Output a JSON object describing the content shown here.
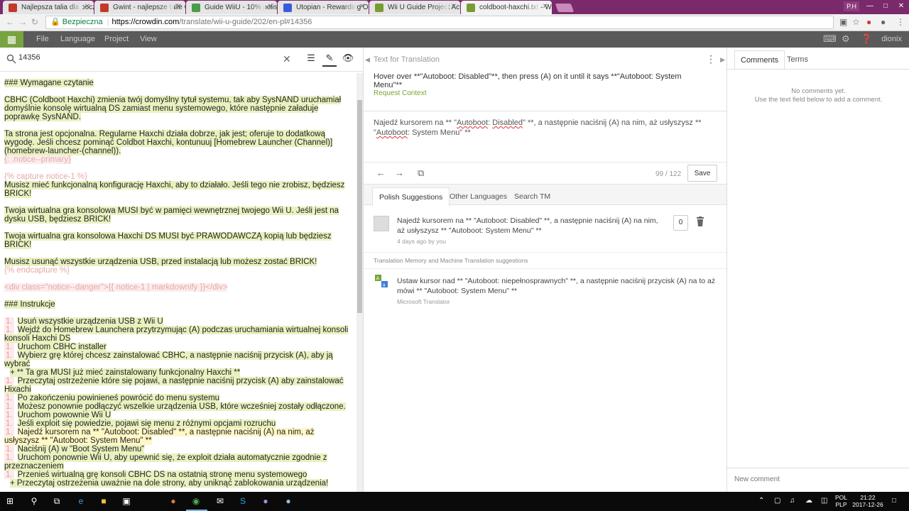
{
  "browser": {
    "profile": "P.H",
    "tabs": [
      {
        "title": "Najlepsza talia dla począt",
        "color": "#c0392b"
      },
      {
        "title": "Gwint - najlepsze talie w",
        "color": "#c0392b"
      },
      {
        "title": "Guide WiiU - 10% polish",
        "color": "#4a9b4a"
      },
      {
        "title": "Utopian - Rewarding Op",
        "color": "#3b5bdb"
      },
      {
        "title": "Wii U Guide Project Activ",
        "color": "#7a9b34"
      },
      {
        "title": "coldboot-haxchi.txt - W",
        "color": "#7a9b34"
      }
    ],
    "address": {
      "secure_label": "Bezpieczna",
      "host": "https://crowdin.com",
      "path": "/translate/wii-u-guide/202/en-pl#14356"
    }
  },
  "app": {
    "menu": [
      "File",
      "Language",
      "Project",
      "View"
    ],
    "username": "dionix",
    "accent": "#78a33e"
  },
  "editor": {
    "search_value": "14356",
    "source_lines": [
      {
        "t": "### Wymagane czytanie",
        "c": "hl",
        "gap": true
      },
      {
        "t": "CBHC (Coldboot Haxchi) zmienia twój domyślny tytuł systemu, tak aby SysNAND uruchamiał domyślnie konsolę wirtualną DS zamiast menu systemowego, które następnie załaduje poprawkę SysNAND.",
        "c": "hl",
        "gap": true
      },
      {
        "t": "Ta strona jest opcjonalna. Regularne Haxchi działa dobrze, jak jest; oferuje to dodatkową wygodę. Jeśli chcesz pominąć Coldbot Haxchi, kontunuuj [Homebrew Launcher (Channel)](homebrew-launcher-(channel)).",
        "c": "hl",
        "gap": false
      },
      {
        "t": "{: .notice--primary}",
        "c": "pink",
        "gap": true
      },
      {
        "t": "{% capture notice-1 %}",
        "c": "tag",
        "gap": false
      },
      {
        "t": "Musisz mieć funkcjonalną konfigurację Haxchi, aby to działało. Jeśli tego nie zrobisz, będziesz BRICK!",
        "c": "hl",
        "gap": true
      },
      {
        "t": "Twoja wirtualna gra konsolowa MUSI być w pamięci wewnętrznej twojego Wii U. Jeśli jest na dysku USB, będziesz BRICK!",
        "c": "hl",
        "gap": true
      },
      {
        "t": "Twoja wirtualna gra konsolowa Haxchi DS MUSI być PRAWODAWCZĄ kopią lub będziesz BRICK!",
        "c": "hl",
        "gap": true
      },
      {
        "t": "Musisz usunąć wszystkie urządzenia USB, przed instalacją lub możesz zostać BRICK!",
        "c": "hl",
        "gap": false
      },
      {
        "t": "{% endcapture %}",
        "c": "tag",
        "gap": true
      },
      {
        "t": "<div class=\"notice--danger\">{{ notice-1 | markdownify }}</div>",
        "c": "pink",
        "gap": true
      },
      {
        "t": "### Instrukcje",
        "c": "hl",
        "gap": true
      }
    ],
    "steps": [
      {
        "t": "Usuń wszystkie urządzenia USB z Wii U",
        "c": "hl"
      },
      {
        "t": "Wejdź do Homebrew Launchera przytrzymując (A) podczas uruchamiania wirtualnej konsoli konsoli Haxchi DS",
        "c": "hl"
      },
      {
        "t": "Uruchom CBHC installer",
        "c": "hl"
      },
      {
        "t": "Wybierz grę której chcesz zainstalować CBHC, a następnie naciśnij przycisk (A), aby ją wybrać",
        "c": "hl"
      },
      {
        "t": "+ ** Ta gra MUSI już mieć zainstalowany funkcjonalny Haxchi **",
        "c": "hl",
        "sub": true
      },
      {
        "t": "Przeczytaj ostrzeżenie które się pojawi, a następnie naciśnij przycisk (A) aby zainstalować Hixachi",
        "c": "hl"
      },
      {
        "t": "Po zakończeniu powinieneś powrócić do menu systemu",
        "c": "hl"
      },
      {
        "t": "Możesz ponownie podłączyć wszelkie urządzenia USB, które wcześniej zostały odłączone.",
        "c": "hl"
      },
      {
        "t": "Uruchom powownie Wii U",
        "c": "hl"
      },
      {
        "t": "Jeśli exploit się powiedzie, pojawi się menu z różnymi opcjami rozruchu",
        "c": "hl"
      },
      {
        "t": "Najedź kursorem na ** \"Autoboot: Disabled\" **, a następnie naciśnij (A) na nim, aż usłyszysz ** \"Autoboot: System Menu\" **",
        "c": "yl"
      },
      {
        "t": "Naciśnij (A) w \"Boot System Menu\"",
        "c": "hl"
      },
      {
        "t": "Uruchom ponownie Wii U, aby upewnić się, że exploit działa automatycznie zgodnie z przeznaczeniem",
        "c": "hl"
      },
      {
        "t": "Przenieś wirtualną grę konsoli CBHC DS na ostatnią stronę menu systemowego",
        "c": "hl"
      },
      {
        "t": "+ Przeczytaj ostrzeżenia uważnie na dole strony, aby uniknąć zablokowania urządzenia!",
        "c": "hl",
        "sub": true
      }
    ],
    "step_number": "1.",
    "rule": "___",
    "closing": "Twoje urządzenie powinno teraz automatycznie uruchomić się w Coldboot Haxchi załatane SysNAND na starcie."
  },
  "translation": {
    "header": "Text for Translation",
    "source": "Hover over **\"Autoboot: Disabled\"**, then press (A) on it until it says **\"Autoboot: System Menu\"**",
    "request_context": "Request Context",
    "text_parts": [
      "Najedź kursorem na ** \"",
      "Autoboot",
      ": ",
      "Disabled",
      "\" **, a następnie naciśnij (A) na nim, aż usłyszysz ** \"",
      "Autoboot",
      ": System Menu\" **"
    ],
    "counter": "99 / 122",
    "save_label": "Save",
    "tabs": [
      "Polish Suggestions",
      "Other Languages",
      "Search TM"
    ],
    "suggestion": {
      "text": "Najedź kursorem na ** \"Autoboot: Disabled\" **, a następnie naciśnij (A) na nim, aż usłyszysz ** \"Autoboot: System Menu\" **",
      "meta": "4 days ago by you",
      "votes": "0"
    },
    "tm_header": "Translation Memory and Machine Translation suggestions",
    "mt": {
      "text": "Ustaw kursor nad ** \"Autoboot: niepełnosprawnych\" **, a następnie naciśnij przycisk (A) na to aż mówi ** \"Autoboot: System Menu\" **",
      "source": "Microsoft Translator"
    }
  },
  "comments": {
    "tabs": [
      "Comments",
      "Terms"
    ],
    "empty_line1": "No comments yet.",
    "empty_line2": "Use the text field below to add a comment.",
    "placeholder": "New comment"
  },
  "taskbar": {
    "lang_top": "POL",
    "lang_bottom": "PLP",
    "time": "21:22",
    "date": "2017-12-26"
  }
}
